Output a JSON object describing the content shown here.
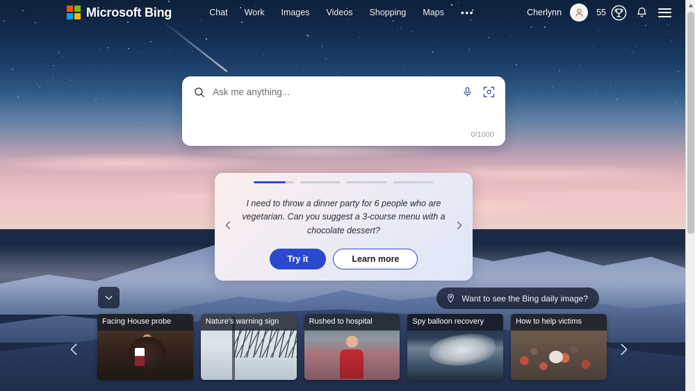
{
  "header": {
    "brand": "Microsoft Bing",
    "logo_colors": [
      "#f25022",
      "#7fba00",
      "#00a4ef",
      "#ffb900"
    ],
    "nav": [
      {
        "label": "Chat",
        "name": "chat"
      },
      {
        "label": "Work",
        "name": "work"
      },
      {
        "label": "Images",
        "name": "images"
      },
      {
        "label": "Videos",
        "name": "videos"
      },
      {
        "label": "Shopping",
        "name": "shopping"
      },
      {
        "label": "Maps",
        "name": "maps"
      }
    ],
    "more_label": "•••",
    "user_name": "Cherlynn",
    "rewards_count": "55",
    "avatar_icon": "person-icon",
    "rewards_icon": "trophy-icon",
    "notification_icon": "bell-icon",
    "menu_icon": "hamburger-icon"
  },
  "search": {
    "placeholder": "Ask me anything...",
    "value": "",
    "counter": "0/1000",
    "search_icon": "search-icon",
    "mic_icon": "microphone-icon",
    "camera_icon": "visual-search-icon"
  },
  "prompt_card": {
    "text": "I need to throw a dinner party for 6 people who are vegetarian. Can you suggest a 3-course menu with a chocolate dessert?",
    "try_label": "Try it",
    "learn_label": "Learn more",
    "prev_icon": "chevron-left-icon",
    "next_icon": "chevron-right-icon",
    "progress": [
      80,
      0,
      0,
      0
    ],
    "accent_color": "#2a49cf"
  },
  "daily_image": {
    "label": "Want to see the Bing daily image?",
    "icon": "info-pin-icon"
  },
  "collapse": {
    "icon": "chevron-down-icon"
  },
  "news": {
    "prev_icon": "chevron-left-icon",
    "next_icon": "chevron-right-icon",
    "cards": [
      {
        "title": "Facing House probe",
        "art": "thumb-a"
      },
      {
        "title": "Nature's warning sign",
        "art": "thumb-b"
      },
      {
        "title": "Rushed to hospital",
        "art": "thumb-c"
      },
      {
        "title": "Spy balloon recovery",
        "art": "thumb-d"
      },
      {
        "title": "How to help victims",
        "art": "thumb-e"
      }
    ]
  },
  "scrollbar": {
    "up_icon": "scroll-up-arrow-icon"
  }
}
